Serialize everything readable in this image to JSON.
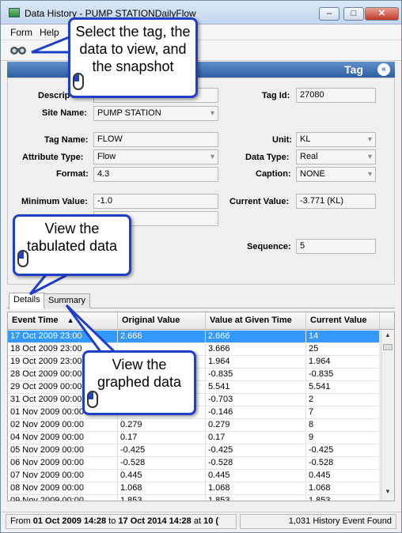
{
  "window": {
    "title": "Data History - PUMP STATIONDailyFlow",
    "min_glyph": "–",
    "max_glyph": "□",
    "close_glyph": "✕"
  },
  "menu": {
    "items": [
      {
        "label": "Form"
      },
      {
        "label": "Help"
      }
    ]
  },
  "tag_header": {
    "label": "Tag",
    "collapse_glyph": "«"
  },
  "form": {
    "description_label": "Descrip",
    "site_name_label": "Site Name:",
    "site_name": "PUMP STATION",
    "tag_id_label": "Tag Id:",
    "tag_id": "27080",
    "tag_name_label": "Tag Name:",
    "tag_name": "FLOW",
    "unit_label": "Unit:",
    "unit": "KL",
    "attribute_type_label": "Attribute Type:",
    "attribute_type": "Flow",
    "data_type_label": "Data Type:",
    "data_type": "Real",
    "format_label": "Format:",
    "format": "4.3",
    "caption_label": "Caption:",
    "caption": "NONE",
    "min_value_label": "Minimum Value:",
    "min_value": "-1.0",
    "current_value_label": "Current Value:",
    "current_value": "-3.771 (KL)",
    "sequence_label": "Sequence:",
    "sequence": "5"
  },
  "tabs": [
    {
      "label": "Details"
    },
    {
      "label": "Summary"
    }
  ],
  "grid": {
    "columns": [
      "Event Time",
      "Original Value",
      "Value at Given Time",
      "Current Value"
    ],
    "sort_glyph": "▲",
    "rows": [
      [
        "17 Oct 2009 23:00",
        "2.666",
        "2.666",
        "14"
      ],
      [
        "18 Oct 2009 23:00",
        "",
        "3.666",
        "25"
      ],
      [
        "19 Oct 2009 23:00",
        "",
        "1.964",
        "1.964"
      ],
      [
        "28 Oct 2009 00:00",
        "",
        "-0.835",
        "-0.835"
      ],
      [
        "29 Oct 2009 00:00",
        "",
        "5.541",
        "5.541"
      ],
      [
        "31 Oct 2009 00:00",
        "",
        "-0.703",
        "2"
      ],
      [
        "01 Nov 2009 00:00",
        "",
        "-0.146",
        "7"
      ],
      [
        "02 Nov 2009 00:00",
        "0.279",
        "0.279",
        "8"
      ],
      [
        "04 Nov 2009 00:00",
        "0.17",
        "0.17",
        "9"
      ],
      [
        "05 Nov 2009 00:00",
        "-0.425",
        "-0.425",
        "-0.425"
      ],
      [
        "06 Nov 2009 00:00",
        "-0.528",
        "-0.528",
        "-0.528"
      ],
      [
        "07 Nov 2009 00:00",
        "0.445",
        "0.445",
        "0.445"
      ],
      [
        "08 Nov 2009 00:00",
        "1.068",
        "1.068",
        "1.068"
      ],
      [
        "09 Nov 2009 00:00",
        "1.853",
        "1.853",
        "1.853"
      ]
    ]
  },
  "status": {
    "from_label": "From",
    "from": "01 Oct 2009 14:28",
    "to_label": "to",
    "to": "17 Oct 2014 14:28",
    "at_label": "at",
    "at": "10 (",
    "count": "1,031 History Event Found"
  },
  "callouts": {
    "select": "Select the tag, the data to view, and the snapshot",
    "tabulated": "View the tabulated data",
    "graphed": "View the graphed data"
  },
  "colors": {
    "accent": "#1f3fc8",
    "selection": "#3399ff",
    "tag_bar": "#2c5fa0"
  }
}
